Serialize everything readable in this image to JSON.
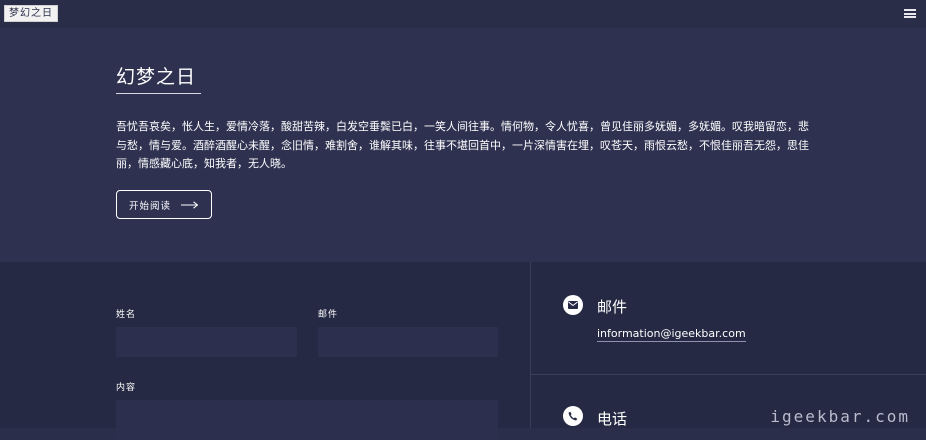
{
  "header": {
    "logo_text": "梦幻之日"
  },
  "banner": {
    "title": "幻梦之日",
    "intro": "吾忧吾哀矣，怅人生，爱情冷落，酸甜苦辣，白发空垂鬓已白，一笑人间往事。情何物，令人忧喜，曾见佳丽多妩媚，多妩媚。叹我暗留恋，悲与愁，情与爱。酒醉酒醒心未醒，念旧情，难割舍，谁解其味，往事不堪回首中，一片深情害在埋，叹苍天，雨恨云愁，不恨佳丽吾无怨，思佳丽，情感藏心底，知我者，无人晓。",
    "read_button": "开始阅读"
  },
  "form": {
    "name_label": "姓名",
    "email_label": "邮件",
    "content_label": "内容"
  },
  "contact": {
    "email_title": "邮件",
    "email_value": "information@igeekbar.com",
    "phone_title": "电话"
  },
  "watermark": "igeekbar.com"
}
